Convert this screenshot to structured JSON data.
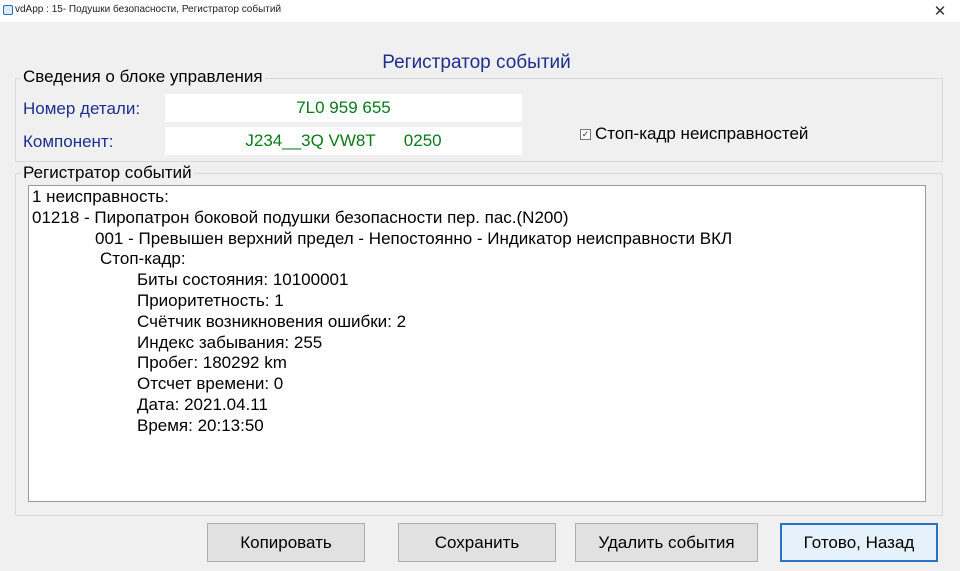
{
  "window": {
    "title": "vdApp : 15- Подушки безопасности,  Регистратор событий",
    "close_glyph": "✕"
  },
  "heading": "Регистратор событий",
  "control_unit": {
    "legend": "Сведения о блоке управления",
    "part_number_label": "Номер детали:",
    "part_number_value": "7L0 959 655",
    "component_label": "Компонент:",
    "component_value": "J234__3Q VW8T      0250"
  },
  "freeze_frame": {
    "label": "Стоп-кадр неисправностей",
    "checked": true,
    "check_glyph": "✓"
  },
  "event_log": {
    "legend": "Регистратор событий",
    "lines": [
      {
        "indent": 0,
        "text": "1 неисправность:"
      },
      {
        "indent": 0,
        "text": "01218 - Пиропатрон боковой подушки безопасности пер. пас.(N200)"
      },
      {
        "indent": 1,
        "text": "001 - Превышен верхний предел - Непостоянно - Индикатор неисправности ВКЛ"
      },
      {
        "indent": 2,
        "text": "Стоп-кадр:"
      },
      {
        "indent": 3,
        "text": "Биты состояния: 10100001"
      },
      {
        "indent": 3,
        "text": "Приоритетность: 1"
      },
      {
        "indent": 3,
        "text": "Счётчик возникновения ошибки: 2"
      },
      {
        "indent": 3,
        "text": "Индекс забывания: 255"
      },
      {
        "indent": 3,
        "text": "Пробег: 180292 km"
      },
      {
        "indent": 3,
        "text": "Отсчет времени: 0"
      },
      {
        "indent": 3,
        "text": "Дата: 2021.04.11"
      },
      {
        "indent": 3,
        "text": "Время: 20:13:50"
      }
    ]
  },
  "buttons": {
    "copy": "Копировать",
    "save": "Сохранить",
    "delete_events": "Удалить события",
    "done_back": "Готово, Назад"
  },
  "colors": {
    "label_blue": "#1f2f8f",
    "value_green": "#0a7a1a",
    "default_button_border": "#2a72c8"
  }
}
